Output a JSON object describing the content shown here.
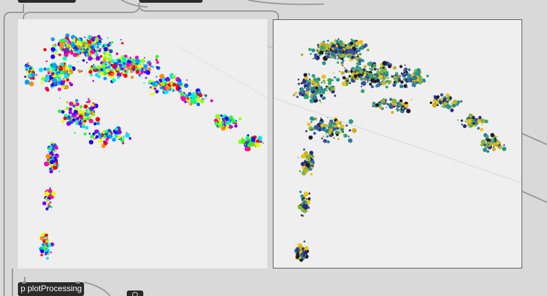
{
  "patcher": {
    "objects": {
      "plot_processing_label": "p plotProcessing"
    }
  },
  "colors": {
    "canvas_bg": "#d9d9d9",
    "plot_bg": "#efefef",
    "object_bg": "#2b2b2b",
    "cord": "#9a9a9a",
    "left_palette": [
      "#1d00ff",
      "#0055ff",
      "#00a0ff",
      "#00e5ff",
      "#00ffb0",
      "#22ff33",
      "#8dff00",
      "#e4ff00",
      "#ff8a00",
      "#ff0000",
      "#ff00b5",
      "#7f00ff"
    ],
    "right_palette": [
      "#2f2a7e",
      "#3a4fa3",
      "#2c7aa6",
      "#22998f",
      "#3aa46b",
      "#86b33a",
      "#c9b21c",
      "#ebc116",
      "#211a2f"
    ]
  },
  "icons": {
    "plot_left": "scatter-plot-icon",
    "plot_right": "scatter-plot-icon",
    "toggle": "circle-icon"
  }
}
